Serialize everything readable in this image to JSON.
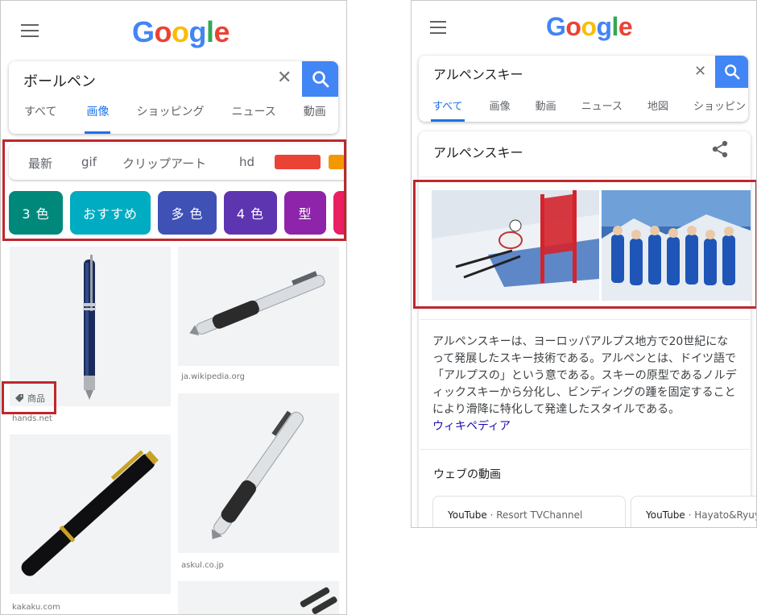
{
  "left": {
    "logo": [
      "G",
      "o",
      "o",
      "g",
      "l",
      "e"
    ],
    "search": {
      "query": "ボールペン"
    },
    "tabs": [
      "すべて",
      "画像",
      "ショッピング",
      "ニュース",
      "動画"
    ],
    "active_tab": "画像",
    "filters": [
      "最新",
      "gif",
      "クリップアート",
      "hd"
    ],
    "swatches": [
      "#ea4335",
      "#f29900"
    ],
    "color_chips": [
      {
        "label": "3 色",
        "color": "#00897b"
      },
      {
        "label": "おすすめ",
        "color": "#00acc1"
      },
      {
        "label": "多 色",
        "color": "#3f51b5"
      },
      {
        "label": "4 色",
        "color": "#5e35b1"
      },
      {
        "label": "型",
        "color": "#8e24aa"
      },
      {
        "label": "",
        "color": "#e91e63"
      }
    ],
    "results": [
      {
        "source": "hands.net",
        "tag": "商品"
      },
      {
        "source": "ja.wikipedia.org"
      },
      {
        "source": "askul.co.jp"
      },
      {
        "source": "kakaku.com"
      }
    ]
  },
  "right": {
    "logo": [
      "G",
      "o",
      "o",
      "g",
      "l",
      "e"
    ],
    "search": {
      "query": "アルペンスキー"
    },
    "tabs": [
      "すべて",
      "画像",
      "動画",
      "ニュース",
      "地図",
      "ショッピン"
    ],
    "active_tab": "すべて",
    "knowledge_title": "アルペンスキー",
    "description": "アルペンスキーは、ヨーロッパアルプス地方で20世紀になって発展したスキー技術である。アルペンとは、ドイツ語で「アルプスの」という意である。スキーの原型であるノルディックスキーから分化し、ビンディングの踵を固定することにより滑降に特化して発達したスタイルである。",
    "wiki_link": "ウィキペディア",
    "web_videos_title": "ウェブの動画",
    "videos": [
      {
        "platform": "YouTube",
        "channel": "· Resort TVChannel"
      },
      {
        "platform": "YouTube",
        "channel": "· Hayato&Ryuy"
      }
    ]
  },
  "colors": {
    "accent": "#4285f4",
    "active_tab": "#1a73e8",
    "highlight": "#c0262d"
  }
}
